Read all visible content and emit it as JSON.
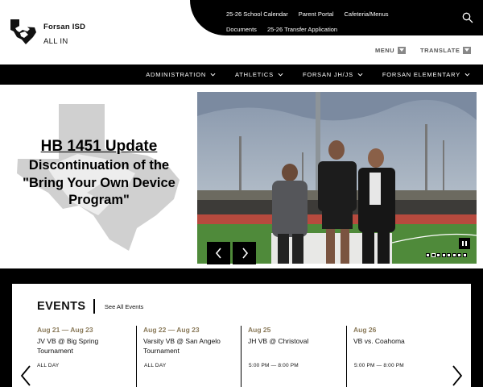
{
  "header": {
    "district": "Forsan ISD",
    "tagline": "ALL IN",
    "top_links": [
      "25-26 School Calendar",
      "Parent Portal",
      "Cafeteria/Menus",
      "Documents",
      "25-26 Transfer Application"
    ],
    "menu_label": "MENU",
    "translate_label": "TRANSLATE"
  },
  "nav": {
    "items": [
      "ADMINISTRATION",
      "ATHLETICS",
      "FORSAN JH/JS",
      "FORSAN ELEMENTARY"
    ]
  },
  "hero": {
    "title": "HB 1451 Update",
    "subtitle": "Discontinuation of the \"Bring Your Own Device Program\"",
    "slide_count": 8,
    "active_slide": 1
  },
  "events": {
    "title": "EVENTS",
    "see_all": "See All Events",
    "items": [
      {
        "date": "Aug 21 — Aug 23",
        "name": "JV VB @ Big Spring Tournament",
        "time": "ALL DAY"
      },
      {
        "date": "Aug 22 — Aug 23",
        "name": "Varsity VB @ San Angelo Tournament",
        "time": "ALL DAY"
      },
      {
        "date": "Aug 25",
        "name": "JH VB @ Christoval",
        "time": "5:00 PM — 8:00 PM"
      },
      {
        "date": "Aug 26",
        "name": "VB vs. Coahoma",
        "time": "5:00 PM — 8:00 PM"
      }
    ]
  },
  "colors": {
    "black": "#000000",
    "event_date": "#8a7a5a",
    "texas_watermark": "#d0d0d0"
  },
  "icons": [
    "mustang-logo-icon",
    "search-icon",
    "chevron-down-icon",
    "prev-arrow-icon",
    "next-arrow-icon",
    "pause-icon"
  ]
}
